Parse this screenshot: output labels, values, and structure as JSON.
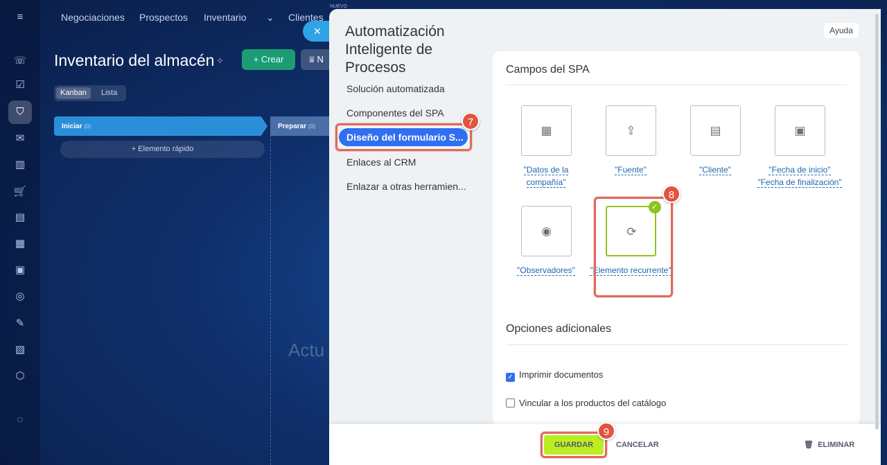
{
  "nav": {
    "items": [
      "Negociaciones",
      "Prospectos",
      "Inventario",
      "Clientes"
    ],
    "new_tag": "NUEVO"
  },
  "page": {
    "title": "Inventario del almacén",
    "create_label": "+ Crear",
    "filter_label": "N",
    "view_tabs": [
      "Kanban",
      "Lista"
    ],
    "stages": [
      {
        "name": "Iniciar",
        "count": "(0)"
      },
      {
        "name": "Preparar",
        "count": "(0)"
      }
    ],
    "quick_add": "+ Elemento rápido",
    "bg_text": "Actu"
  },
  "slider": {
    "title": "Automatización Inteligente de Procesos",
    "help_label": "Ayuda",
    "menu": [
      "Solución automatizada",
      "Componentes del SPA",
      "Diseño del formulario S...",
      "Enlaces al CRM",
      "Enlazar a otras herramien..."
    ],
    "fields_section_title": "Campos del SPA",
    "fields": [
      {
        "label": "\"Datos de la compañía\"",
        "icon": "building-icon"
      },
      {
        "label": "\"Fuente\"",
        "icon": "share-icon"
      },
      {
        "label": "\"Cliente\"",
        "icon": "id-card-icon"
      },
      {
        "label": "\"Fecha de inicio\" \"Fecha de finalización\"",
        "icon": "calendar-icon"
      },
      {
        "label": "\"Observadores\"",
        "icon": "eye-icon"
      },
      {
        "label": "\"Elemento recurrente\"",
        "icon": "repeat-icon",
        "selected": true
      }
    ],
    "options_section_title": "Opciones adicionales",
    "options": [
      {
        "label": "Imprimir documentos",
        "checked": true
      },
      {
        "label": "Vincular a los productos del catálogo",
        "checked": false
      }
    ],
    "footer": {
      "save_label": "GUARDAR",
      "cancel_label": "CANCELAR",
      "delete_label": "ELIMINAR"
    },
    "step_badges": [
      "7",
      "8",
      "9"
    ]
  },
  "colors": {
    "accent_blue": "#2f6ff0",
    "save_green": "#bbed21",
    "highlight_red": "#e06a5b",
    "selected_green": "#8fc31f"
  }
}
